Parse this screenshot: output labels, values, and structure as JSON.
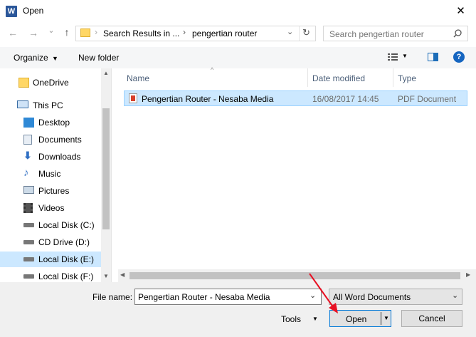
{
  "window": {
    "title": "Open",
    "close_glyph": "✕",
    "app_icon": "W"
  },
  "nav": {
    "back_glyph": "←",
    "forward_glyph": "→",
    "recent_glyph": "⌄",
    "up_glyph": "↑",
    "address": {
      "part1": "Search Results in ...",
      "separator": "›",
      "part2": "pengertian router",
      "chevron": "⌄",
      "refresh_glyph": "↻"
    },
    "search": {
      "placeholder": "Search pengertian router"
    }
  },
  "toolbar": {
    "organize_label": "Organize",
    "new_folder_label": "New folder",
    "help_glyph": "?"
  },
  "sidebar": {
    "items": [
      {
        "label": "OneDrive",
        "icon": "folder-icon"
      },
      {
        "label": "This PC",
        "icon": "computer-icon"
      },
      {
        "label": "Desktop",
        "icon": "desktop-icon"
      },
      {
        "label": "Documents",
        "icon": "documents-icon"
      },
      {
        "label": "Downloads",
        "icon": "downloads-icon"
      },
      {
        "label": "Music",
        "icon": "music-icon"
      },
      {
        "label": "Pictures",
        "icon": "pictures-icon"
      },
      {
        "label": "Videos",
        "icon": "videos-icon"
      },
      {
        "label": "Local Disk (C:)",
        "icon": "drive-icon"
      },
      {
        "label": "CD Drive (D:)",
        "icon": "cd-drive-icon"
      },
      {
        "label": "Local Disk (E:)",
        "icon": "drive-icon",
        "selected": true
      },
      {
        "label": "Local Disk (F:)",
        "icon": "drive-icon"
      }
    ]
  },
  "filelist": {
    "columns": [
      "Name",
      "Date modified",
      "Type"
    ],
    "rows": [
      {
        "name": "Pengertian Router - Nesaba Media",
        "date": "16/08/2017 14:45",
        "type": "PDF Document"
      }
    ]
  },
  "footer": {
    "filename_label": "File name:",
    "filename_value": "Pengertian Router - Nesaba Media",
    "filetype_value": "All Word Documents",
    "tools_label": "Tools",
    "open_label": "Open",
    "cancel_label": "Cancel"
  },
  "colors": {
    "selection": "#cce8ff",
    "accent": "#0078d7",
    "arrow": "#e81123"
  }
}
